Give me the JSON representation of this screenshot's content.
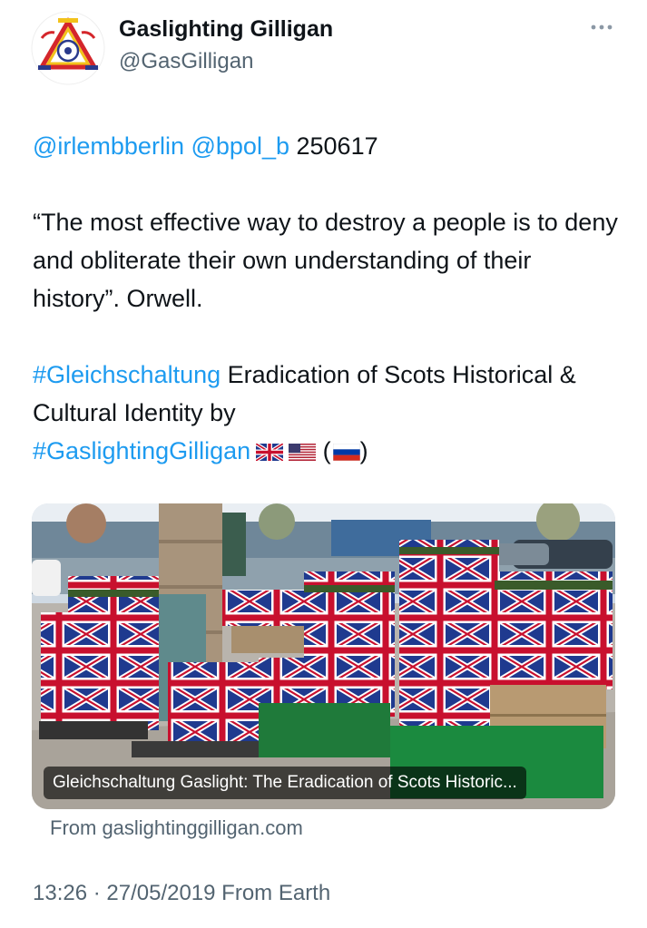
{
  "author": {
    "name": "Gaslighting Gilligan",
    "handle": "@GasGilligan",
    "avatar_icon": "triangle-emblem-icon"
  },
  "tweet": {
    "mention1": "@irlembberlin",
    "mention2": "@bpol_b",
    "code": "250617",
    "quote_line": "“The most effective way to destroy a people is to deny and obliterate their own understanding of their history”. Orwell.",
    "hashtag1": "#Gleichschaltung",
    "text_after_hashtag": "Eradication of Scots Historical & Cultural Identity by",
    "hashtag2": "#GaslightingGilligan",
    "flags": [
      "uk-flag-icon",
      "us-flag-icon",
      "russia-flag-icon"
    ],
    "paren_open": "(",
    "paren_close": ")"
  },
  "card": {
    "caption": "Gleichschaltung Gaslight: The Eradication of Scots Historic...",
    "source": "From gaslightinggilligan.com"
  },
  "meta": {
    "time_date": "13:26 · 27/05/2019 From Earth"
  },
  "colors": {
    "link": "#1d9bf0",
    "secondary": "#536471",
    "text": "#0f1419"
  }
}
